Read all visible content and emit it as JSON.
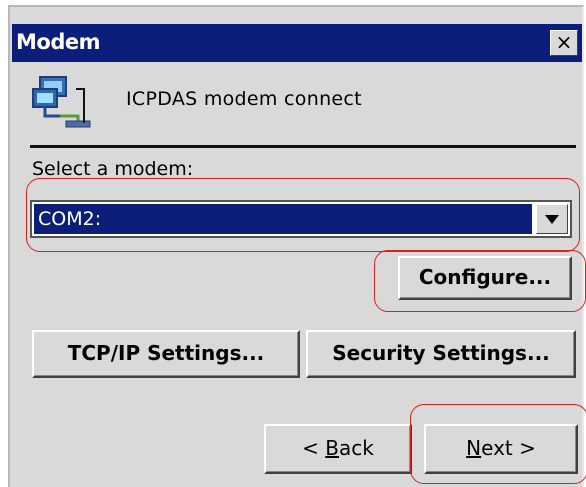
{
  "dialog": {
    "title": "Modem",
    "close_symbol": "×",
    "app_name": "ICPDAS modem connect",
    "icon": "network-connection-icon"
  },
  "modem_select": {
    "label": "Select a modem:",
    "selected_value": "COM2:"
  },
  "buttons": {
    "configure": "Configure...",
    "tcp_ip_settings": "TCP/IP Settings...",
    "security_settings": "Security Settings...",
    "back_prefix": "< ",
    "back_accel": "B",
    "back_rest": "ack",
    "next_accel": "N",
    "next_rest": "ext >"
  },
  "colors": {
    "titlebar": "#0b1f7a",
    "dialog_background": "#d9d9d9",
    "selection": "#0b1f7a",
    "annotation": "#d82020"
  }
}
